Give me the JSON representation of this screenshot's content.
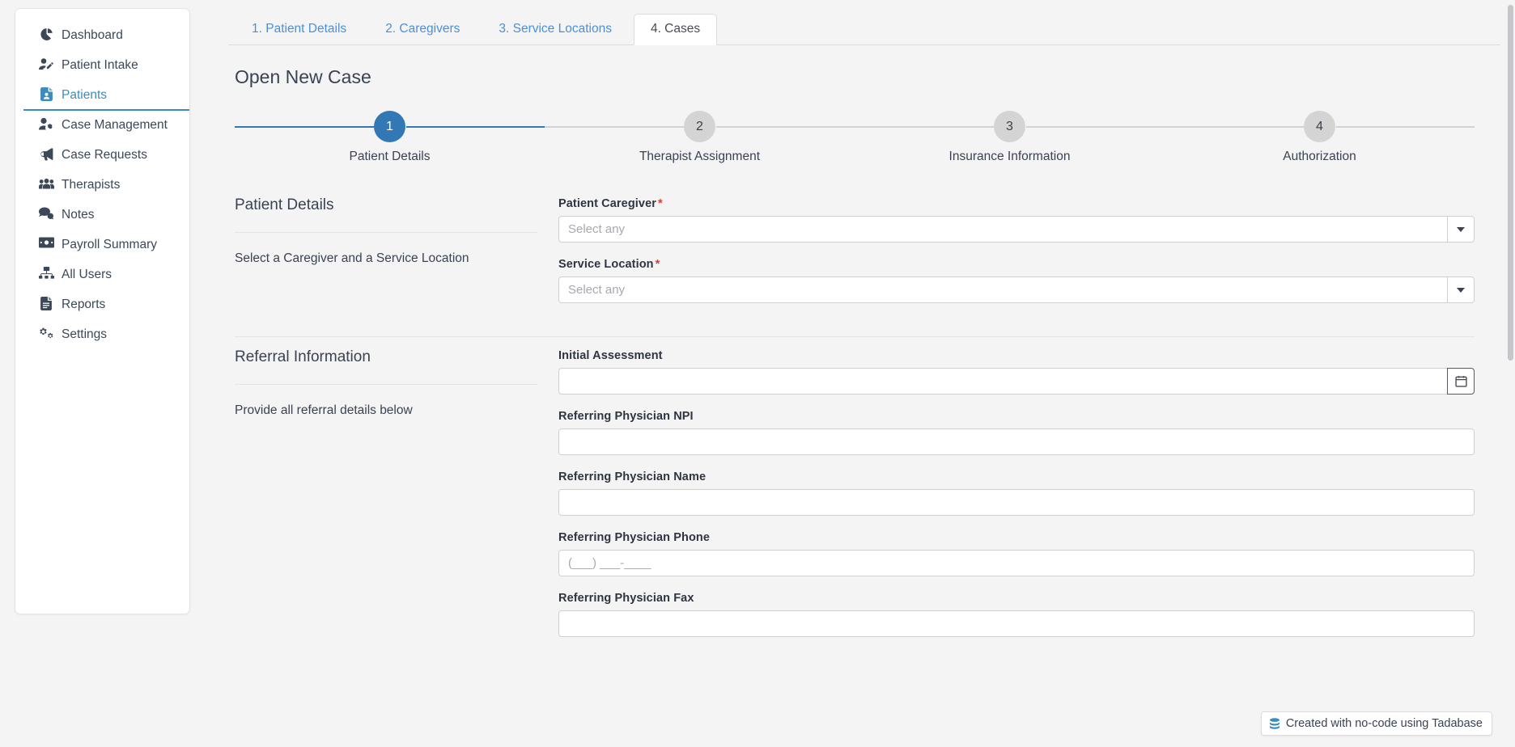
{
  "sidebar": {
    "items": [
      {
        "label": "Dashboard",
        "icon": "pie-chart-icon",
        "active": false
      },
      {
        "label": "Patient Intake",
        "icon": "user-edit-icon",
        "active": false
      },
      {
        "label": "Patients",
        "icon": "file-user-icon",
        "active": true
      },
      {
        "label": "Case Management",
        "icon": "user-cog-icon",
        "active": false
      },
      {
        "label": "Case Requests",
        "icon": "bullhorn-icon",
        "active": false
      },
      {
        "label": "Therapists",
        "icon": "users-icon",
        "active": false
      },
      {
        "label": "Notes",
        "icon": "comments-icon",
        "active": false
      },
      {
        "label": "Payroll Summary",
        "icon": "money-bill-icon",
        "active": false
      },
      {
        "label": "All Users",
        "icon": "sitemap-users-icon",
        "active": false
      },
      {
        "label": "Reports",
        "icon": "file-lines-icon",
        "active": false
      },
      {
        "label": "Settings",
        "icon": "gears-icon",
        "active": false
      }
    ]
  },
  "tabs": [
    {
      "label": "1. Patient Details",
      "active": false
    },
    {
      "label": "2. Caregivers",
      "active": false
    },
    {
      "label": "3. Service Locations",
      "active": false
    },
    {
      "label": "4. Cases",
      "active": true
    }
  ],
  "page": {
    "title": "Open New Case"
  },
  "stepper": {
    "steps": [
      {
        "number": "1",
        "label": "Patient Details",
        "state": "done"
      },
      {
        "number": "2",
        "label": "Therapist Assignment",
        "state": "todo"
      },
      {
        "number": "3",
        "label": "Insurance Information",
        "state": "todo"
      },
      {
        "number": "4",
        "label": "Authorization",
        "state": "todo"
      }
    ]
  },
  "sections": [
    {
      "title": "Patient Details",
      "description": "Select a Caregiver and a Service Location",
      "fields": [
        {
          "label": "Patient Caregiver",
          "required": true,
          "type": "select",
          "value": "",
          "placeholder": "Select any"
        },
        {
          "label": "Service Location",
          "required": true,
          "type": "select",
          "value": "",
          "placeholder": "Select any"
        }
      ]
    },
    {
      "title": "Referral Information",
      "description": "Provide all referral details below",
      "fields": [
        {
          "label": "Initial Assessment",
          "required": false,
          "type": "date",
          "value": "",
          "placeholder": ""
        },
        {
          "label": "Referring Physician NPI",
          "required": false,
          "type": "text",
          "value": "",
          "placeholder": ""
        },
        {
          "label": "Referring Physician Name",
          "required": false,
          "type": "text",
          "value": "",
          "placeholder": ""
        },
        {
          "label": "Referring Physician Phone",
          "required": false,
          "type": "text",
          "value": "",
          "placeholder": "(___) ___-____"
        },
        {
          "label": "Referring Physician Fax",
          "required": false,
          "type": "text",
          "value": "",
          "placeholder": ""
        }
      ]
    }
  ],
  "badge": {
    "text": "Created with no-code using Tadabase",
    "icon": "database-icon"
  },
  "colors": {
    "accent_blue": "#3c8dbc",
    "link_blue": "#4a90d9",
    "step_active": "#3178b5",
    "step_inactive": "#d4d4d4",
    "required_red": "#e03b33",
    "page_bg": "#f4f4f5",
    "text": "#3b4251"
  }
}
